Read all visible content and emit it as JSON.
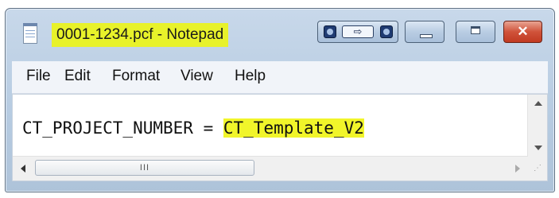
{
  "window": {
    "title": "0001-1234.pcf - Notepad",
    "title_highlight": "#e8f22a",
    "close_glyph": "✕",
    "extra_glyph": "⇨"
  },
  "menu": {
    "items": [
      "File",
      "Edit",
      "Format",
      "View",
      "Help"
    ]
  },
  "editor": {
    "key": "CT_PROJECT_NUMBER = ",
    "value": "CT_Template_V2",
    "highlight_color": "#f1f52a"
  },
  "scrollbar": {
    "thumb_grip": "III"
  },
  "icons": [
    "notepad-icon",
    "minimize-icon",
    "maximize-icon",
    "close-icon",
    "scroll-up-icon",
    "scroll-down-icon",
    "scroll-left-icon",
    "scroll-right-icon",
    "resize-grip-icon"
  ]
}
